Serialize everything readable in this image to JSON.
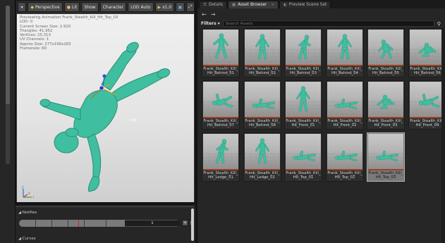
{
  "viewport": {
    "toolbar": {
      "menu_icon": "dropdown-icon",
      "perspective": "Perspective",
      "lit": "Lit",
      "show": "Show",
      "character": "Character",
      "lod": "LOD Auto",
      "speed": "x1.0"
    },
    "info": {
      "line1": "Previewing Animation Frank_Stealth_Kill_Hit_Top_03",
      "line2": "LOD: 0",
      "line3": "Current Screen Size: 2.920",
      "line4": "Triangles: 41,952",
      "line5": "Vertices: 25,313",
      "line6": "UV Channels: 1",
      "line7": "Approx Size: 277x196x283",
      "line8": "Framerate: 60"
    },
    "root_label": "root",
    "axis": {
      "x": "X",
      "y": "Y",
      "z": "Z"
    }
  },
  "timeline": {
    "notifies": "Notifies",
    "value": "1",
    "curves": "Curves",
    "progress": 0.66,
    "playhead": 0.37
  },
  "tabs": [
    {
      "label": "Details",
      "icon": "details-icon"
    },
    {
      "label": "Asset Browser",
      "icon": "browser-icon",
      "active": true
    },
    {
      "label": "Preview Scene Set",
      "icon": "scene-icon"
    }
  ],
  "nav": {
    "back": "←",
    "forward": "→"
  },
  "filters": {
    "label": "Filters",
    "placeholder": "Search Assets"
  },
  "assets": [
    {
      "line1": "Frank_Stealth_Kill_",
      "line2": "Hit_Behind_01",
      "pose": "walk"
    },
    {
      "line1": "Frank_Stealth_Kill_",
      "line2": "Hit_Behind_02",
      "pose": "stand"
    },
    {
      "line1": "Frank_Stealth_Kill_",
      "line2": "Hit_Behind_03",
      "pose": "lean"
    },
    {
      "line1": "Frank_Stealth_Kill_",
      "line2": "Hit_Behind_04",
      "pose": "stand"
    },
    {
      "line1": "Frank_Stealth_Kill_",
      "line2": "Hit_Behind_05",
      "pose": "crouch"
    },
    {
      "line1": "Frank_Stealth_Kill_",
      "line2": "Hit_Behind_06",
      "pose": "kneel"
    },
    {
      "line1": "Frank_Stealth_Kill_",
      "line2": "Hit_Behind_07",
      "pose": "fall"
    },
    {
      "line1": "Frank_Stealth_Kill_",
      "line2": "Hit_Behind_08",
      "pose": "lie"
    },
    {
      "line1": "Frank_Stealth_Kill_",
      "line2": "Hit_Front_01",
      "pose": "stand"
    },
    {
      "line1": "Frank_Stealth_Kill_",
      "line2": "Hit_Front_02",
      "pose": "lie"
    },
    {
      "line1": "Frank_Stealth_Kill_",
      "line2": "Hit_Front_03",
      "pose": "kneel"
    },
    {
      "line1": "Frank_Stealth_Kill_",
      "line2": "Hit_Front_04",
      "pose": "fall"
    },
    {
      "line1": "Frank_Stealth_Kill_",
      "line2": "Hit_Ledge_01",
      "pose": "lean"
    },
    {
      "line1": "Frank_Stealth_Kill_",
      "line2": "Hit_Ledge_02",
      "pose": "stand"
    },
    {
      "line1": "Frank_Stealth_Kill_",
      "line2": "Hit_Top_01",
      "pose": "lie"
    },
    {
      "line1": "Frank_Stealth_Kill_",
      "line2": "Hit_Top_02",
      "pose": "lie"
    },
    {
      "line1": "Frank_Stealth_Kill_",
      "line2": "Hit_Top_03",
      "pose": "lie",
      "selected": true
    }
  ],
  "colors": {
    "character": "#3fbf9f",
    "selected": "#7a7a7a",
    "playhead": "#c03020"
  }
}
